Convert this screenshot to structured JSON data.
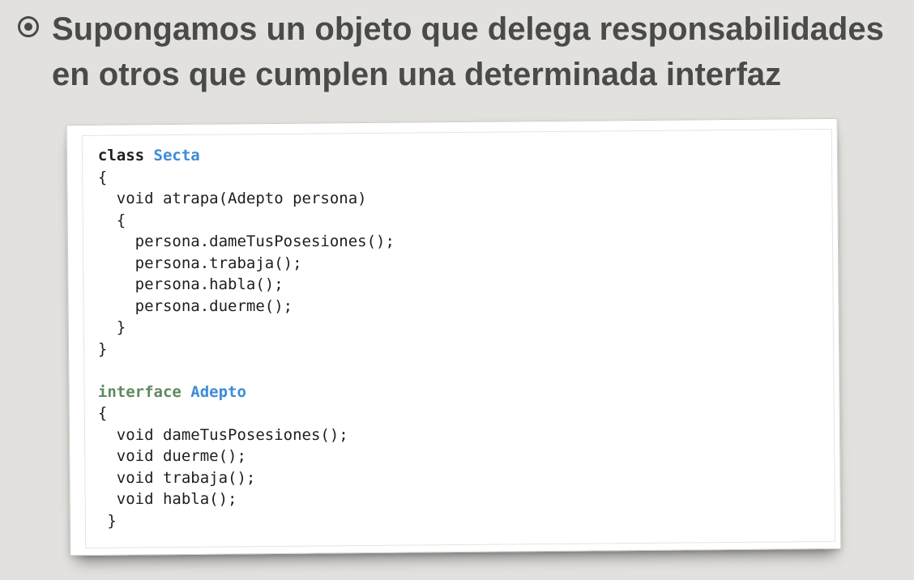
{
  "slide": {
    "heading_line1": "Supongamos un objeto que delega responsabilidades",
    "heading_line2": "en otros que cumplen una determinada interfaz",
    "bullet_icon": "radio-bullet-icon"
  },
  "colors": {
    "background": "#e3e1de",
    "heading": "#4a4a4a",
    "type_name": "#3d8bd9",
    "interface_keyword": "#5f8a5f"
  },
  "code": {
    "class_keyword": "class",
    "class_name": "Secta",
    "class_open": "{",
    "method_sig": "  void atrapa(Adepto persona)",
    "method_open": "  {",
    "stmt1": "    persona.dameTusPosesiones();",
    "stmt2": "    persona.trabaja();",
    "stmt3": "    persona.habla();",
    "stmt4": "    persona.duerme();",
    "method_close": "  }",
    "class_close": "}",
    "interface_keyword": "interface",
    "interface_name": "Adepto",
    "iface_open": "{",
    "iface_m1": "  void dameTusPosesiones();",
    "iface_m2": "  void duerme();",
    "iface_m3": "  void trabaja();",
    "iface_m4": "  void habla();",
    "iface_close": " }"
  }
}
